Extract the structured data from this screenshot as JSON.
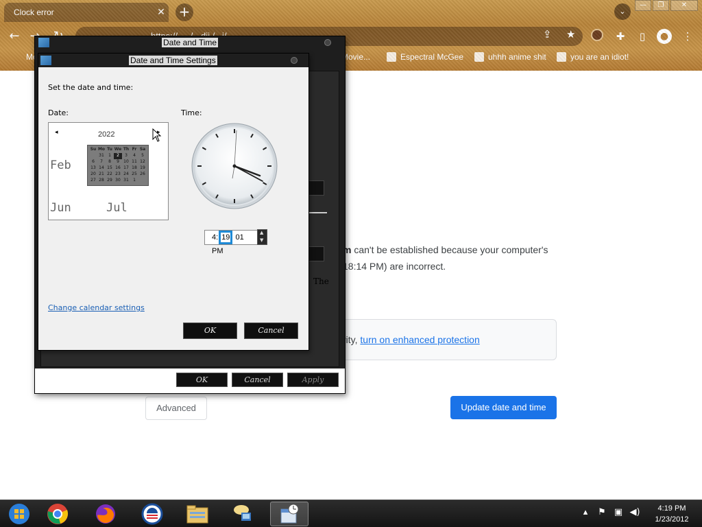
{
  "browser": {
    "tab_title": "Clock error",
    "tab_close": "✕",
    "new_tab": "+",
    "address": "https://... ·/ · dii /...i/",
    "window_buttons": [
      "—",
      "❐",
      "✕"
    ],
    "bookmarks": [
      {
        "label": "Mc",
        "icon": "folder-icon"
      },
      {
        "label": "Movie...",
        "icon": "bookmark-icon"
      },
      {
        "label": "Espectral McGee",
        "icon": "bookmark-icon"
      },
      {
        "label": "uhhh anime shit",
        "icon": "bookmark-icon"
      },
      {
        "label": "you are an idiot!",
        "icon": "flag-uk-icon"
      }
    ]
  },
  "page": {
    "error_line1_bold": "m",
    "error_line1_rest": " can't be established because your computer's",
    "error_line2": "18:14 PM) are incorrect.",
    "protect_prefix": "rity, ",
    "protect_link": "turn on enhanced protection",
    "advanced_label": "Advanced",
    "update_label": "Update date and time"
  },
  "outer_dialog": {
    "title": "Date and Time",
    "side_text": "The",
    "buttons": {
      "ok": "OK",
      "cancel": "Cancel",
      "apply": "Apply"
    }
  },
  "settings_dialog": {
    "title": "Date and Time Settings",
    "instruction": "Set the date and time:",
    "date_label": "Date:",
    "time_label": "Time:",
    "calendar": {
      "year": "2022",
      "prev": "◂",
      "next": "▸",
      "month_left": "Feb",
      "month_bottom_left": "Jun",
      "month_bottom_right": "Jul",
      "headers": [
        "Su",
        "Mo",
        "Tu",
        "We",
        "Th",
        "Fr",
        "Sa"
      ],
      "days": [
        "",
        "31",
        "1",
        "2",
        "3",
        "4",
        "5",
        "6",
        "7",
        "8",
        "9",
        "10",
        "11",
        "12",
        "13",
        "14",
        "15",
        "16",
        "17",
        "18",
        "19",
        "20",
        "21",
        "22",
        "23",
        "24",
        "25",
        "26",
        "27",
        "28",
        "29",
        "30",
        "31",
        "1",
        ""
      ],
      "selected_day": "1"
    },
    "time": {
      "before": "4:",
      "highlight": "19",
      "after": " 01 PM"
    },
    "change_link": "Change calendar settings",
    "ok": "OK",
    "cancel": "Cancel"
  },
  "taskbar": {
    "apps": [
      "start-orb-icon",
      "chrome-icon",
      "firefox-icon",
      "obama-logo-icon",
      "file-explorer-icon",
      "network-icon",
      "calendar-clock-icon"
    ],
    "tray_icons": [
      "chevron-up-icon",
      "flag-icon",
      "network-tray-icon",
      "volume-icon"
    ],
    "time": "4:19 PM",
    "date": "1/23/2012"
  }
}
